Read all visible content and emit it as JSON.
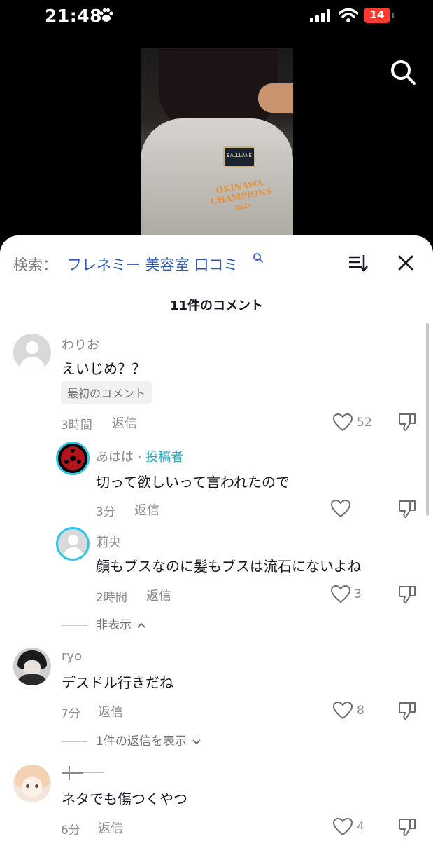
{
  "status": {
    "time": "21:48",
    "battery": "14"
  },
  "video": {
    "jersey_badge": "BALLLANE",
    "jersey_text": "OKINAWA CHAMPIONS",
    "jersey_year": "2024"
  },
  "search": {
    "prefix": "検索：",
    "term": "フレネミー 美容室 口コミ"
  },
  "comment_count": "11件のコメント",
  "comments": [
    {
      "user": "わりお",
      "text": "えいじめ？？",
      "tag": "最初のコメント",
      "time": "3時間",
      "reply": "返信",
      "likes": "52"
    },
    {
      "user": "あはは",
      "separator": " · ",
      "author_label": "投稿者",
      "text": "切って欲しいって言われたので",
      "time": "3分",
      "reply": "返信",
      "likes": ""
    },
    {
      "user": "莉央",
      "text": "顔もブスなのに髪もブスは流石にないよね",
      "time": "2時間",
      "reply": "返信",
      "likes": "3",
      "thread_toggle": "非表示"
    },
    {
      "user": "ryo",
      "text": "デスドル行きだね",
      "time": "7分",
      "reply": "返信",
      "likes": "8",
      "thread_toggle": "1件の返信を表示"
    },
    {
      "user": "",
      "text": "ネタでも傷つくやつ",
      "time": "6分",
      "reply": "返信",
      "likes": "4"
    }
  ],
  "colors": {
    "accent": "#2b59b8",
    "author": "#20a8c7",
    "ring": "#2fc6e8"
  }
}
